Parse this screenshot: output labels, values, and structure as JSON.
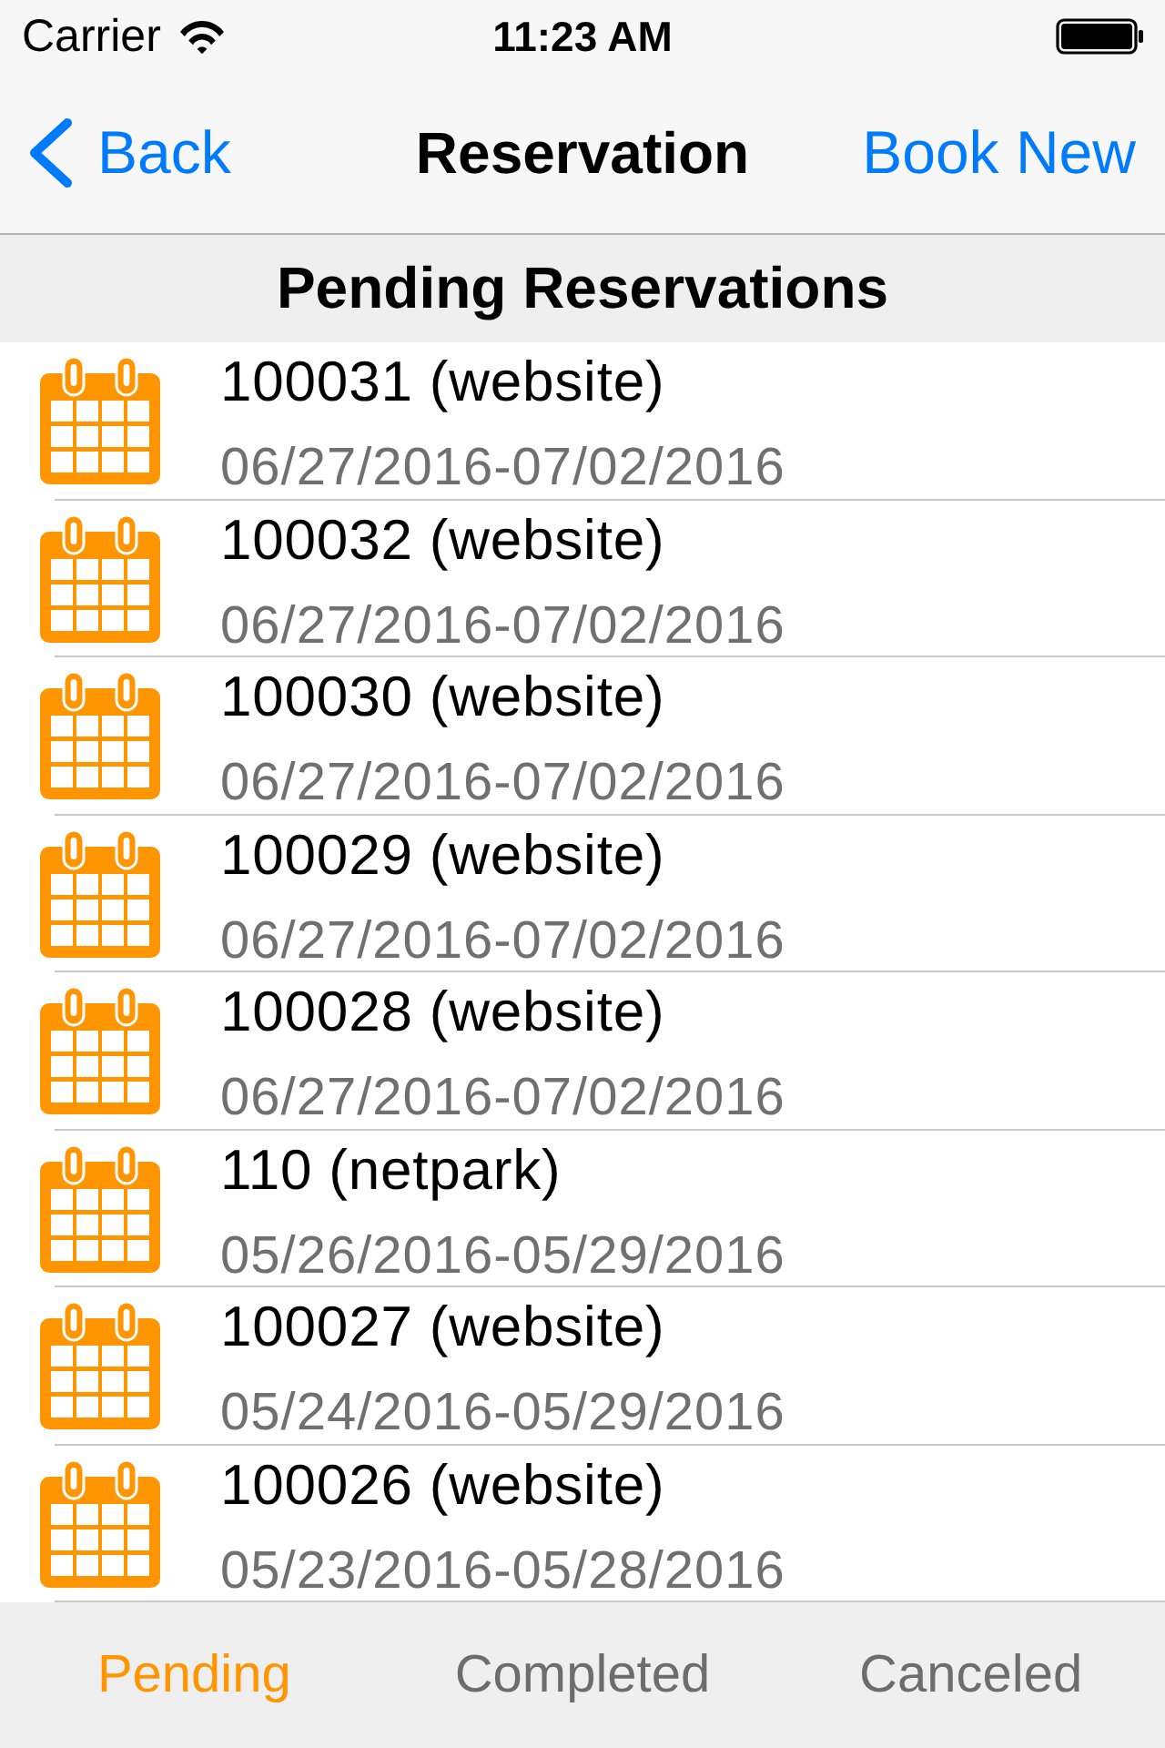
{
  "status_bar": {
    "carrier": "Carrier",
    "time": "11:23 AM"
  },
  "nav_bar": {
    "back": "Back",
    "title": "Reservation",
    "action": "Book New"
  },
  "section_header": "Pending Reservations",
  "reservations": [
    {
      "title": "100031 (website)",
      "dates": "06/27/2016-07/02/2016"
    },
    {
      "title": "100032 (website)",
      "dates": "06/27/2016-07/02/2016"
    },
    {
      "title": "100030 (website)",
      "dates": "06/27/2016-07/02/2016"
    },
    {
      "title": "100029 (website)",
      "dates": "06/27/2016-07/02/2016"
    },
    {
      "title": "100028 (website)",
      "dates": "06/27/2016-07/02/2016"
    },
    {
      "title": "110 (netpark)",
      "dates": "05/26/2016-05/29/2016"
    },
    {
      "title": "100027 (website)",
      "dates": "05/24/2016-05/29/2016"
    },
    {
      "title": "100026 (website)",
      "dates": "05/23/2016-05/28/2016"
    }
  ],
  "tab_bar": {
    "tabs": [
      {
        "label": "Pending",
        "selected": true
      },
      {
        "label": "Completed",
        "selected": false
      },
      {
        "label": "Canceled",
        "selected": false
      }
    ]
  }
}
